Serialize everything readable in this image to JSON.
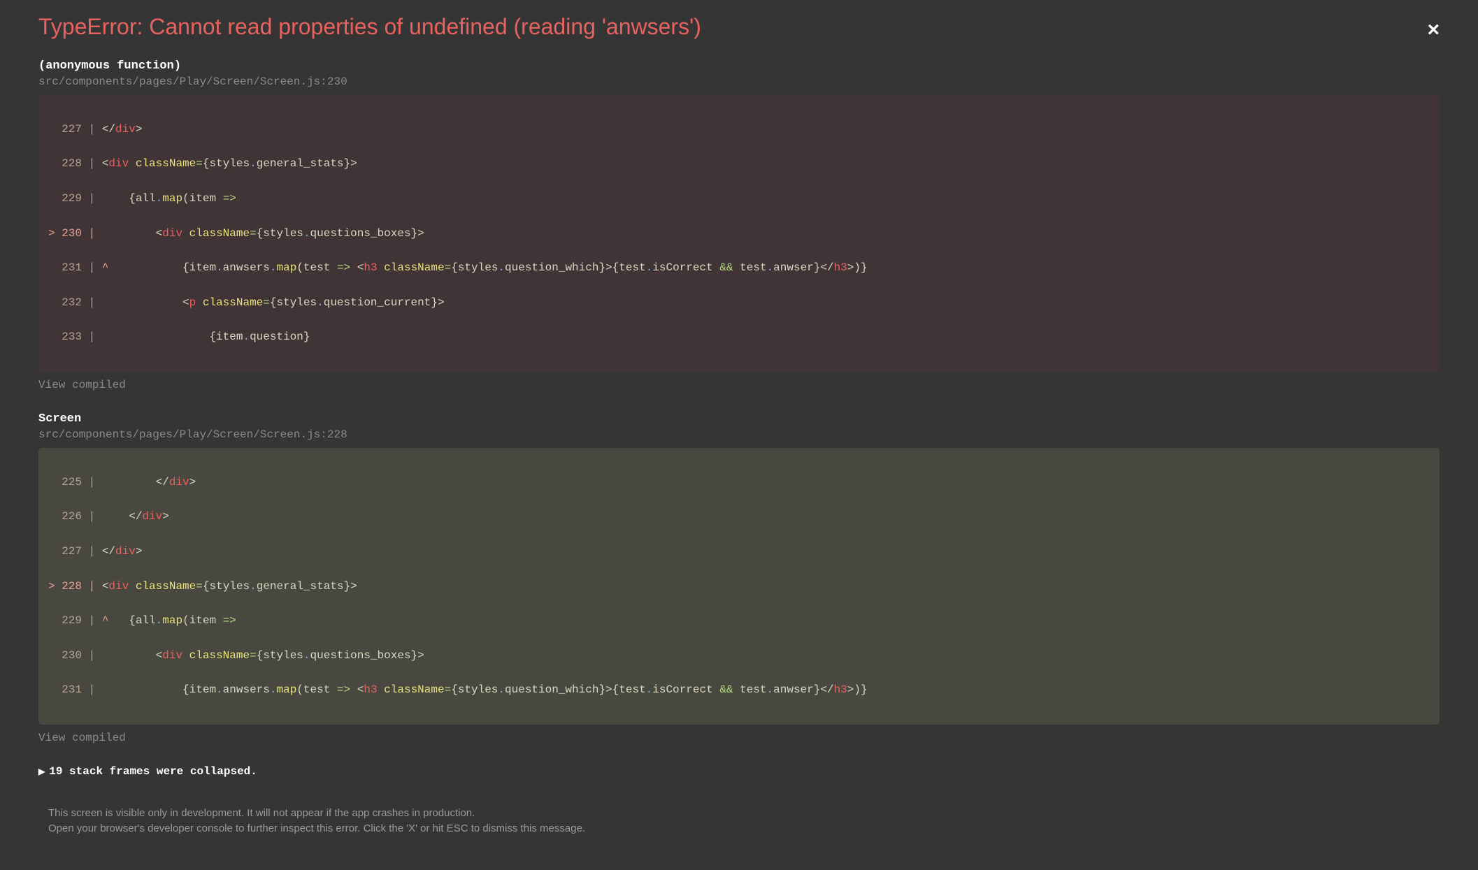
{
  "title": "TypeError: Cannot read properties of undefined (reading 'anwsers')",
  "close_label": "×",
  "frames": [
    {
      "name": "(anonymous function)",
      "location": "src/components/pages/Play/Screen/Screen.js:230",
      "highlighted": true,
      "lines": {
        "l227_pre": "  227 | ",
        "l228_pre": "  228 | ",
        "l229_pre": "  229 | ",
        "l230_pre": "> 230 | ",
        "l231_pre": "  231 | ",
        "l231_caret": "^",
        "l232_pre": "  232 | ",
        "l233_pre": "  233 | "
      }
    },
    {
      "name": "Screen",
      "location": "src/components/pages/Play/Screen/Screen.js:228",
      "highlighted": false,
      "lines": {
        "l225_pre": "  225 | ",
        "l226_pre": "  226 | ",
        "l227_pre": "  227 | ",
        "l228_pre": "> 228 | ",
        "l229_pre": "  229 | ",
        "l229_caret": "^",
        "l230_pre": "  230 | ",
        "l231_pre": "  231 | "
      }
    }
  ],
  "tokens": {
    "close_div": "</div>",
    "open_div": "<div",
    "close_tag": ">",
    "open_h3": "<h3",
    "close_h3": "</h3>",
    "open_p": "<p",
    "className": "className",
    "equals": "=",
    "lbrace": "{",
    "rbrace": "}",
    "styles": "styles",
    "dot": ".",
    "general_stats": "general_stats",
    "questions_boxes": "questions_boxes",
    "question_which": "question_which",
    "question_current": "question_current",
    "all": "all",
    "map": "map",
    "item": "item",
    "anwsers": "anwsers",
    "test": "test",
    "isCorrect": "isCorrect",
    "anwser": "anwser",
    "question": "question",
    "lparen": "(",
    "rparen": ")",
    "arrow": "=>",
    "amp": "&&"
  },
  "view_compiled": "View compiled",
  "collapsed": {
    "arrow": "▶",
    "text": "19 stack frames were collapsed."
  },
  "footer": {
    "line1": "This screen is visible only in development. It will not appear if the app crashes in production.",
    "line2": "Open your browser's developer console to further inspect this error.  Click the 'X' or hit ESC to dismiss this message."
  }
}
